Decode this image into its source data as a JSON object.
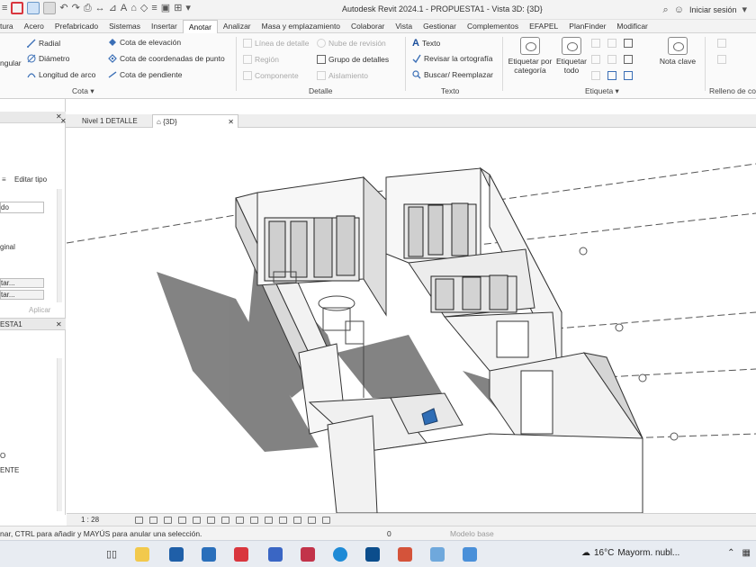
{
  "app": {
    "title": "Autodesk Revit 2024.1 - PROPUESTA1 - Vista 3D: {3D}",
    "signin": "Iniciar sesión"
  },
  "tabs": [
    {
      "label": "tura"
    },
    {
      "label": "Acero"
    },
    {
      "label": "Prefabricado"
    },
    {
      "label": "Sistemas"
    },
    {
      "label": "Insertar"
    },
    {
      "label": "Anotar",
      "active": true
    },
    {
      "label": "Analizar"
    },
    {
      "label": "Masa y emplazamiento"
    },
    {
      "label": "Colaborar"
    },
    {
      "label": "Vista"
    },
    {
      "label": "Gestionar"
    },
    {
      "label": "Complementos"
    },
    {
      "label": "EFAPEL"
    },
    {
      "label": "PlanFinder"
    },
    {
      "label": "Modificar"
    }
  ],
  "ribbon": {
    "cota": {
      "angular": "ngular",
      "radial": "Radial",
      "diametro": "Diámetro",
      "longitud_arco": "Longitud de arco",
      "cota_elevacion": "Cota de elevación",
      "cota_coordenadas": "Cota de coordenadas de punto",
      "cota_pendiente": "Cota de pendiente",
      "label": "Cota ▾"
    },
    "detalle": {
      "linea_detalle": "Línea de detalle",
      "region": "Región",
      "componente": "Componente",
      "nube_revision": "Nube de revisión",
      "grupo_detalles": "Grupo de detalles",
      "aislamiento": "Aislamiento",
      "label": "Detalle"
    },
    "texto": {
      "texto": "Texto",
      "revisar_ortografia": "Revisar la ortografía",
      "buscar_reemplazar": "Buscar/ Reemplazar",
      "label": "Texto"
    },
    "etiqueta": {
      "por_categoria": "Etiquetar por categoría",
      "todo": "Etiquetar todo",
      "nota_clave": "Nota clave",
      "label": "Etiqueta ▾"
    },
    "relleno": {
      "label": "Relleno de co"
    }
  },
  "left_panel": {
    "editar_tipo": "Editar tipo",
    "field_do": "do",
    "ginal": "ginal",
    "btn1": "tar...",
    "btn2": "tar...",
    "aplicar": "Aplicar",
    "project_browser_title": "ESTA1",
    "tree_0": "O",
    "tree_ente": "ENTE"
  },
  "view_tabs": [
    {
      "label": "Nivel 1 DETALLE"
    },
    {
      "label": "{3D}",
      "active": true
    }
  ],
  "viewbar": {
    "scale": "1 : 28"
  },
  "status": {
    "text": "nar, CTRL para añadir y MAYÚS para anular una selección.",
    "model": "Modelo base",
    "selection_count": "0"
  },
  "taskbar": {
    "weather_temp": "16°C",
    "weather_text": "Mayorm. nubl...",
    "apps": [
      "task-view",
      "file-explorer",
      "store",
      "mail",
      "autodesk-access",
      "revit",
      "autodesk-app",
      "edge",
      "dropbox",
      "photos",
      "autodesk-desktop",
      "file-viewer"
    ]
  },
  "colors": {
    "ribbon_bg": "#fafafa",
    "titlebar_bg": "#f3f3f3",
    "taskbar_bg": "#e8ecf2",
    "revit_red": "#d9363e",
    "revit_blue": "#2f6db5"
  }
}
